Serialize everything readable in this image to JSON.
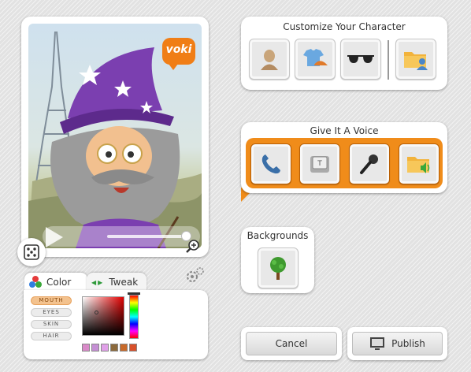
{
  "character": {
    "logo_text": "voki"
  },
  "tabs": {
    "color_label": "Color",
    "tweak_label": "Tweak"
  },
  "parts": {
    "mouth": "MOUTH",
    "eyes": "EYES",
    "skin": "SKIN",
    "hair": "HAIR",
    "selected": "MOUTH"
  },
  "palette": {
    "accent": "#f08c1a",
    "swatches": [
      "#d98ac9",
      "#c58fd4",
      "#e0a0e8",
      "#8c6a3c",
      "#c86a2a",
      "#d8502a"
    ]
  },
  "customize": {
    "title": "Customize Your Character",
    "buttons": [
      "head-icon",
      "clothing-icon",
      "sunglasses-icon",
      "folder-user-icon"
    ]
  },
  "voice": {
    "title": "Give It A Voice",
    "buttons": [
      "phone-icon",
      "keyboard-key-icon",
      "microphone-icon",
      "folder-sound-icon"
    ]
  },
  "backgrounds": {
    "title": "Backgrounds"
  },
  "actions": {
    "cancel_label": "Cancel",
    "publish_label": "Publish"
  }
}
